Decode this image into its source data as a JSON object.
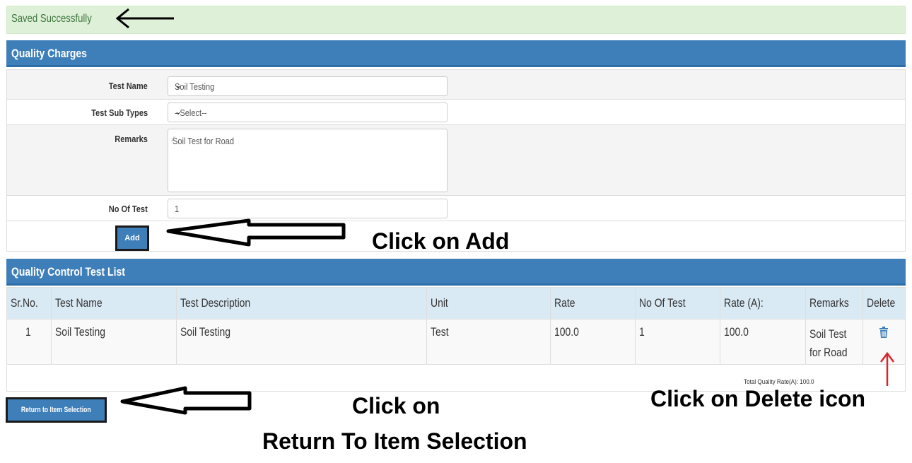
{
  "alert": {
    "message": "Saved Successfully"
  },
  "quality_charges": {
    "title": "Quality Charges",
    "test_name_label": "Test Name",
    "test_name_value": "Soil Testing",
    "sub_types_label": "Test Sub Types",
    "sub_types_value": "--Select--",
    "remarks_label": "Remarks",
    "remarks_value": "Soil Test for Road",
    "no_of_test_label": "No Of Test",
    "no_of_test_value": "1",
    "add_button": "Add"
  },
  "test_list": {
    "title": "Quality Control Test List",
    "columns": [
      "Sr.No.",
      "Test Name",
      "Test Description",
      "Unit",
      "Rate",
      "No Of Test",
      "Rate (A):",
      "Remarks",
      "Delete"
    ],
    "rows": [
      {
        "sr": "1",
        "test_name": "Soil Testing",
        "description": "Soil Testing",
        "unit": "Test",
        "rate": "100.0",
        "no_of_test": "1",
        "rate_a": "100.0",
        "remarks": "Soil Test for Road"
      }
    ],
    "total_label": "Total Quality Rate(A): 100.0"
  },
  "return_button": "Return to Item Selection",
  "annotations": {
    "add": "Click on Add",
    "return_line1": "Click on",
    "return_line2": "Return To Item Selection",
    "delete": "Click on Delete icon"
  },
  "colors": {
    "panel_header": "#3f7fb9",
    "alert_bg": "#dff0d8",
    "table_header": "#daeaf5",
    "delete_icon": "#3f7fb9",
    "red_arrow": "#d9262e"
  },
  "icons": {
    "delete": "trash-icon",
    "select": "chevron-down-icon"
  }
}
